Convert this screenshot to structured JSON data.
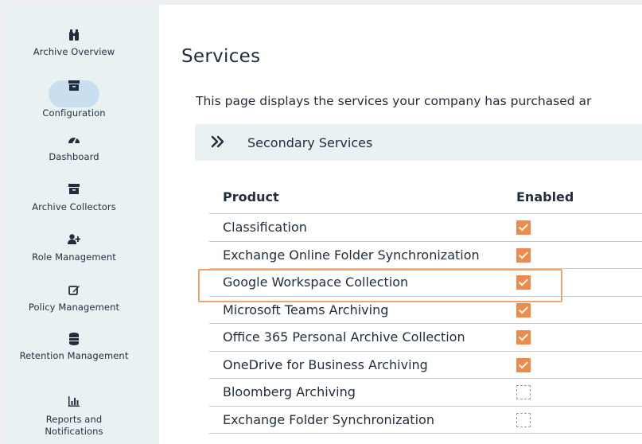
{
  "sidebar": {
    "items": [
      {
        "label": "Archive Overview",
        "icon": "binoculars-icon"
      },
      {
        "label": "Configuration",
        "icon": "archive-box-icon",
        "active": true
      },
      {
        "label": "Dashboard",
        "icon": "dashboard-gauge-icon"
      },
      {
        "label": "Archive Collectors",
        "icon": "archive-box-icon"
      },
      {
        "label": "Role Management",
        "icon": "user-plus-icon"
      },
      {
        "label": "Policy Management",
        "icon": "edit-icon"
      },
      {
        "label": "Retention Management",
        "icon": "database-icon"
      },
      {
        "label": "Reports and Notifications",
        "icon": "bar-chart-icon"
      }
    ]
  },
  "main": {
    "title": "Services",
    "description": "This page displays the services your company has purchased ar",
    "section": {
      "title": "Secondary Services",
      "icon": "double-chevron-right-icon"
    },
    "table": {
      "columns": [
        "Product",
        "Enabled"
      ],
      "rows": [
        {
          "product": "Classification",
          "enabled": true
        },
        {
          "product": "Exchange Online Folder Synchronization",
          "enabled": true
        },
        {
          "product": "Google Workspace Collection",
          "enabled": true,
          "highlighted": true
        },
        {
          "product": "Microsoft Teams Archiving",
          "enabled": true
        },
        {
          "product": "Office 365 Personal Archive Collection",
          "enabled": true
        },
        {
          "product": "OneDrive for Business Archiving",
          "enabled": true
        },
        {
          "product": "Bloomberg Archiving",
          "enabled": false
        },
        {
          "product": "Exchange Folder Synchronization",
          "enabled": false
        }
      ]
    }
  },
  "colors": {
    "accent": "#f08a4a",
    "highlight_border": "#f0a56a",
    "sidebar_bg": "#e9f1f3",
    "active_pill": "#c9dff0",
    "text": "#1f2d3d"
  }
}
